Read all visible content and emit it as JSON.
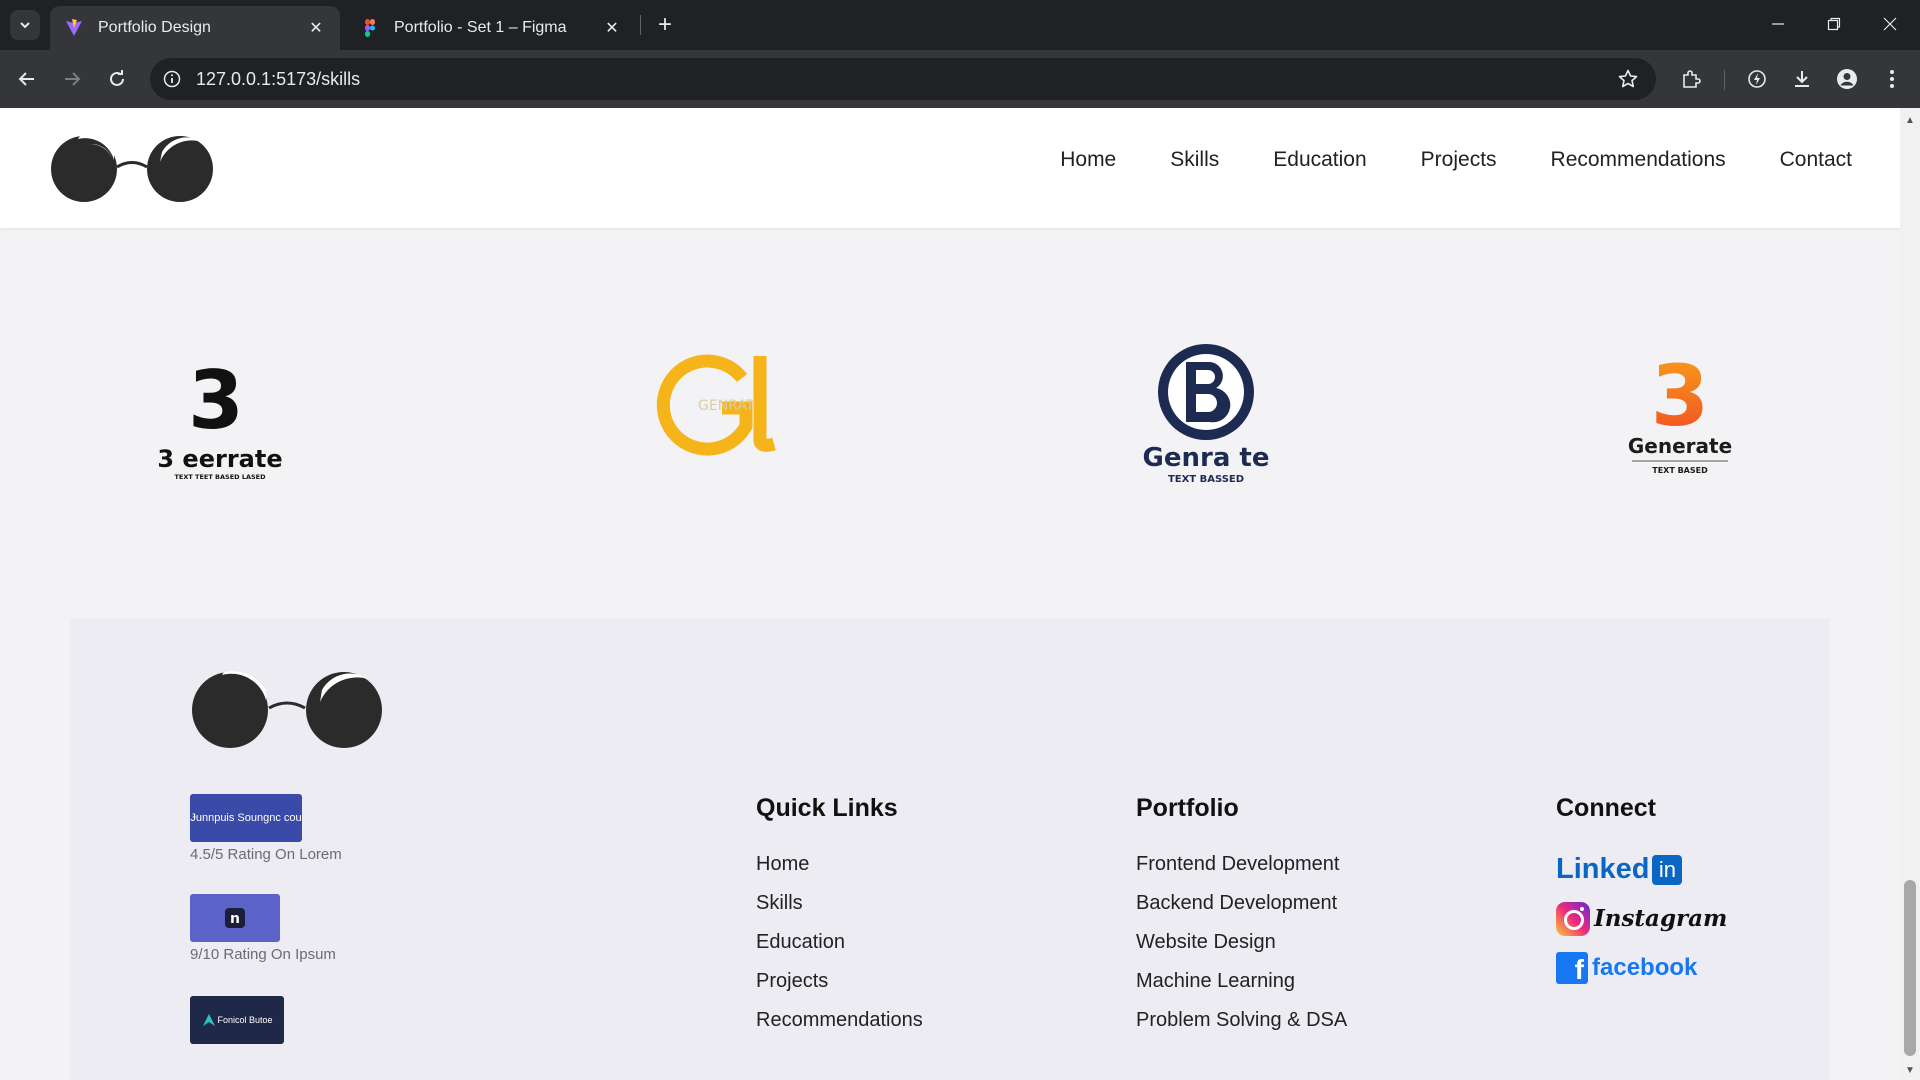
{
  "browser": {
    "tabs": [
      {
        "title": "Portfolio Design",
        "active": true
      },
      {
        "title": "Portfolio - Set 1 – Figma",
        "active": false
      }
    ],
    "url": "127.0.0.1:5173/skills"
  },
  "header": {
    "nav": [
      "Home",
      "Skills",
      "Education",
      "Projects",
      "Recommendations",
      "Contact"
    ]
  },
  "brand_logos": [
    {
      "name": "3 eerrate",
      "tagline": "TEXT TEET BASED LASED",
      "glyph": "3"
    },
    {
      "name": "GENRAT",
      "glyph": "GL"
    },
    {
      "name": "Genra te",
      "tagline": "TEXT BASSED",
      "glyph": "B"
    },
    {
      "name": "Generate",
      "tagline": "TEXT BASED",
      "glyph": "3"
    }
  ],
  "footer": {
    "ratings": [
      {
        "badge": "Ɉunnpuis Soungnc cou",
        "text": "4.5/5 Rating On Lorem"
      },
      {
        "badge": "n",
        "text": "9/10 Rating On Ipsum"
      },
      {
        "badge": "Fonicol Butoe",
        "text": ""
      }
    ],
    "quick_links": {
      "title": "Quick Links",
      "items": [
        "Home",
        "Skills",
        "Education",
        "Projects",
        "Recommendations"
      ]
    },
    "portfolio": {
      "title": "Portfolio",
      "items": [
        "Frontend Development",
        "Backend Development",
        "Website Design",
        "Machine Learning",
        "Problem Solving & DSA"
      ]
    },
    "connect": {
      "title": "Connect",
      "linkedin": "Linked",
      "linkedin_in": "in",
      "instagram": "Instagram",
      "facebook": "facebook",
      "facebook_f": "f"
    }
  },
  "colors": {
    "page_bg": "#f3f3f6",
    "footer_bg": "#ececf2",
    "logo_dark": "#2b2b2b",
    "linkedin": "#0a66c2",
    "facebook": "#1877f2"
  }
}
